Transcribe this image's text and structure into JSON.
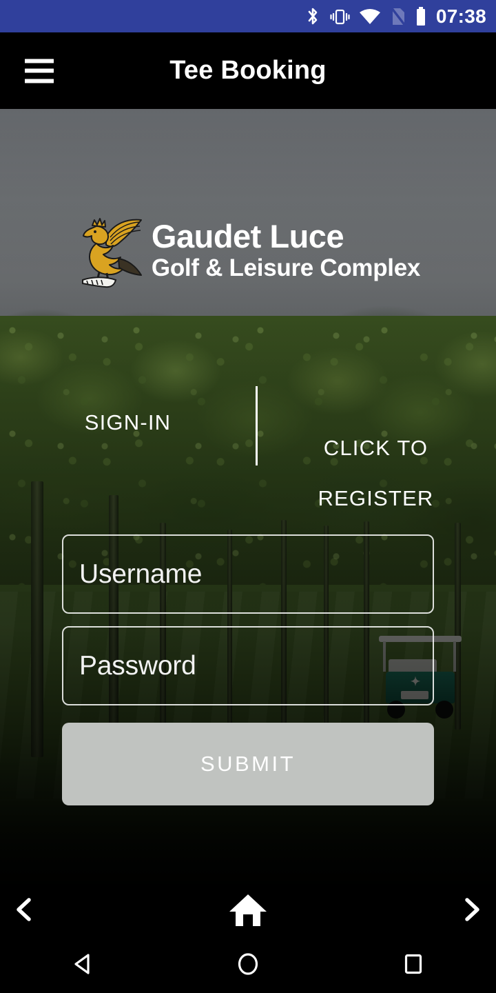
{
  "status_bar": {
    "time": "07:38",
    "background_color": "#30409C",
    "icons": [
      {
        "name": "bluetooth-icon",
        "label": "Bluetooth"
      },
      {
        "name": "vibrate-icon",
        "label": "Vibrate"
      },
      {
        "name": "wifi-icon",
        "label": "Wi-Fi"
      },
      {
        "name": "no-sim-icon",
        "label": "No SIM"
      },
      {
        "name": "battery-icon",
        "label": "Battery"
      }
    ]
  },
  "app_bar": {
    "title": "Tee Booking",
    "menu_icon": "hamburger-menu-icon",
    "background_color": "#000000"
  },
  "branding": {
    "logo_icon": "griffin-logo-icon",
    "name": "Gaudet Luce",
    "tagline": "Golf & Leisure Complex",
    "logo_color": "#D9A321"
  },
  "auth": {
    "signin_label": "SIGN-IN",
    "register_line1": "CLICK TO",
    "register_line2": "REGISTER"
  },
  "form": {
    "username": {
      "placeholder": "Username",
      "value": ""
    },
    "password": {
      "placeholder": "Password",
      "value": ""
    },
    "submit_label": "SUBMIT",
    "submit_color": "#C0C3C0"
  },
  "bottom_nav": {
    "back_icon": "chevron-left-icon",
    "home_icon": "home-icon",
    "forward_icon": "chevron-right-icon"
  },
  "system_nav": {
    "back_icon": "triangle-back-icon",
    "home_icon": "circle-home-icon",
    "recents_icon": "square-recents-icon"
  }
}
